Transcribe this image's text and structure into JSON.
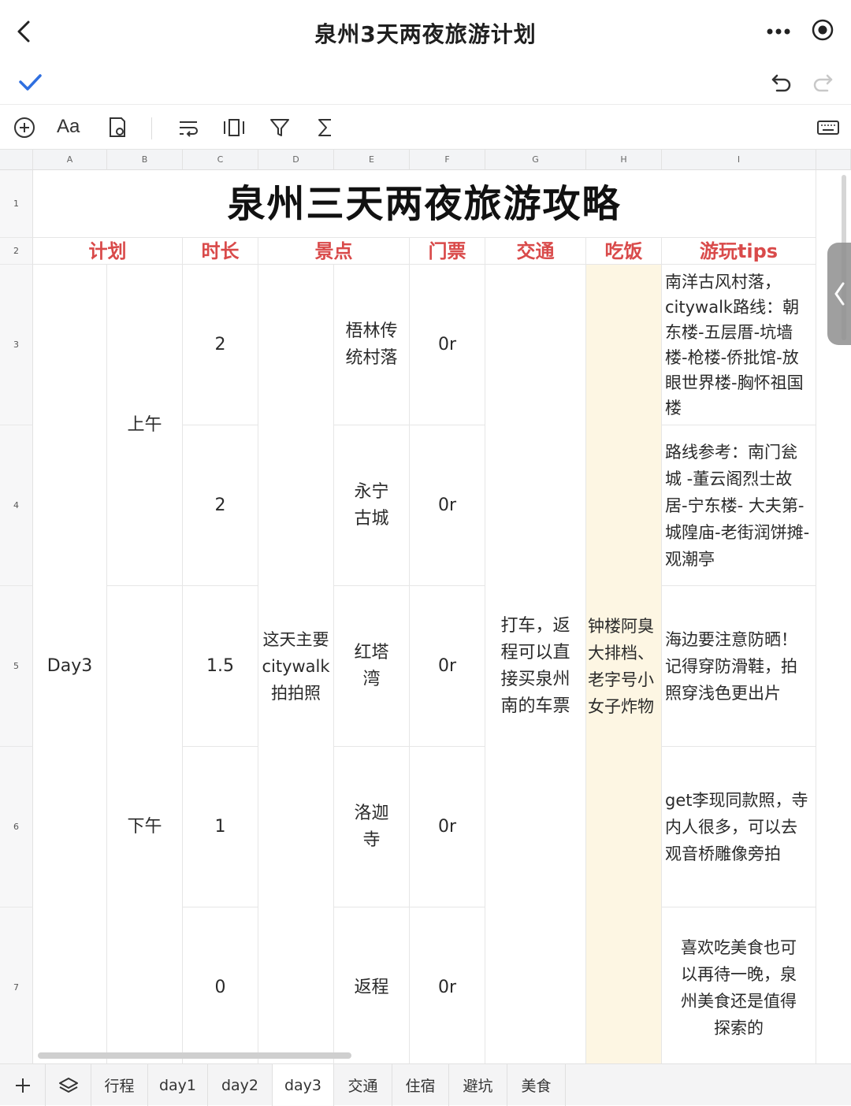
{
  "header": {
    "title": "泉州3天两夜旅游计划"
  },
  "icons": {
    "back": "chevron-left-icon",
    "more": "more-dots-icon",
    "record": "record-icon",
    "check": "check-icon",
    "undo": "undo-icon",
    "redo": "redo-icon"
  },
  "toolbar": {
    "font_label": "Aa"
  },
  "columns": [
    "A",
    "B",
    "C",
    "D",
    "E",
    "F",
    "G",
    "H",
    "I"
  ],
  "rows": [
    "1",
    "2",
    "3",
    "4",
    "5",
    "6",
    "7"
  ],
  "sheet": {
    "title": "泉州三天两夜旅游攻略",
    "headers": {
      "plan": "计划",
      "duration": "时长",
      "spot": "景点",
      "ticket": "门票",
      "transport": "交通",
      "food": "吃饭",
      "tips": "游玩tips"
    },
    "day": "Day3",
    "morning": "上午",
    "afternoon": "下午",
    "theme": "这天主要citywalk拍拍照",
    "transport": "打车，返程可以直接买泉州南的车票",
    "food": "钟楼阿臭大排档、老字号小女子炸物",
    "entries": [
      {
        "duration": "2",
        "spot": "梧林传统村落",
        "ticket": "0r",
        "tips": "南洋古风村落，citywalk路线：朝东楼-五层厝-坑墙楼-枪楼-侨批馆-放眼世界楼-胸怀祖国楼"
      },
      {
        "duration": "2",
        "spot": "永宁古城",
        "ticket": "0r",
        "tips": "路线参考：南门瓮城 -董云阁烈士故居-宁东楼- 大夫第-城隍庙-老街润饼摊-观潮亭"
      },
      {
        "duration": "1.5",
        "spot": "红塔湾",
        "ticket": "0r",
        "tips": "海边要注意防晒！记得穿防滑鞋，拍照穿浅色更出片"
      },
      {
        "duration": "1",
        "spot": "洛迦寺",
        "ticket": "0r",
        "tips": "get李现同款照，寺内人很多，可以去观音桥雕像旁拍"
      },
      {
        "duration": "0",
        "spot": "返程",
        "ticket": "0r",
        "tips": "喜欢吃美食也可以再待一晚，泉州美食还是值得探索的"
      }
    ]
  },
  "tabs": [
    "行程",
    "day1",
    "day2",
    "day3",
    "交通",
    "住宿",
    "避坑",
    "美食"
  ],
  "active_tab": "day3",
  "colors": {
    "header_red": "#d94a4a",
    "food_bg": "#fdf6e3",
    "accent_blue": "#2f6fe0"
  }
}
